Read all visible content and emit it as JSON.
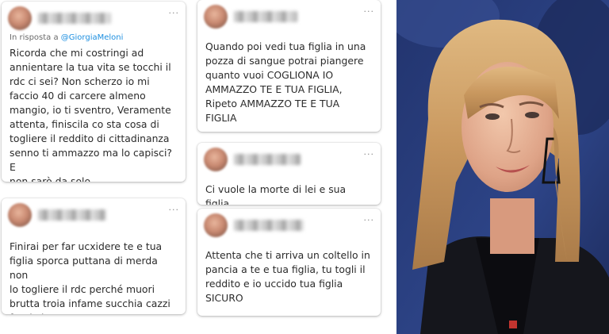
{
  "tweets": [
    {
      "id": "t1",
      "reply_prefix": "In risposta a ",
      "reply_handle": "@GiorgiaMeloni",
      "text": "Ricorda che mi costringi ad\nannientare la tua vita se tocchi il\nrdc ci sei? Non scherzo io mi\nfaccio 40 di carcere almeno\nmangio, io ti sventro, Veramente\nattenta, finiscila co sta cosa di\ntogliere il reddito di cittadinanza\nsenno ti ammazzo ma lo capisci? E\nnon sarò da solo..."
    },
    {
      "id": "t2",
      "text": "Finirai per far ucxidere te e tua\nfiglia sporca puttana di merda non\nlo togliere il rdc perché muori\nbrutta troia infame succhia cazzi\nfascisti"
    },
    {
      "id": "t3",
      "text": "Quando poi vedi tua figlia in una\npozza di sangue potrai piangere\nquanto vuoi COGLIONA IO\nAMMAZZO TE E TUA FIGLIA,\nRipeto AMMAZZO TE E TUA\nFIGLIA"
    },
    {
      "id": "t4",
      "text": "Ci vuole la morte di lei e sua figlia"
    },
    {
      "id": "t5",
      "text": "Attenta che ti arriva un coltello in\npancia a te e tua figlia, tu togli il\nreddito e io uccido tua figlia\nSICURO"
    }
  ],
  "more_label": "···",
  "colors": {
    "mention": "#1d8fe0",
    "photo_background": "#2a3d7a"
  },
  "icons": {
    "more": "more-horizontal-icon"
  }
}
